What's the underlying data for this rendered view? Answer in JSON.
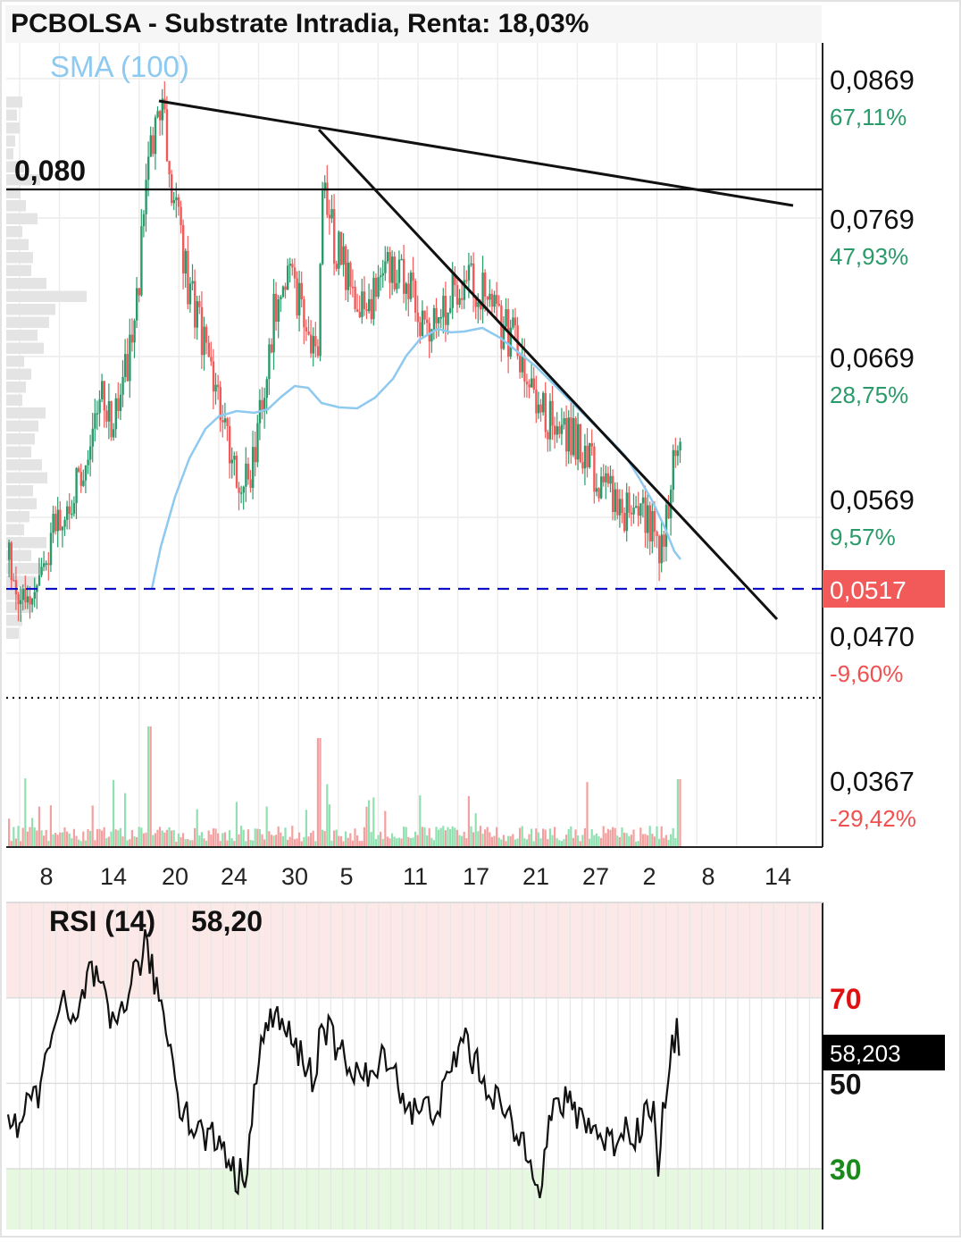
{
  "title": "PCBOLSA - Substrate Intradia, Renta: 18,03%",
  "indicator_label": "SMA (100)",
  "level_label": "0,080",
  "price_axis": [
    {
      "price": "0,0869",
      "pct": "67,11%",
      "pct_color": "#2a9a6a"
    },
    {
      "price": "0,0769",
      "pct": "47,93%",
      "pct_color": "#2a9a6a"
    },
    {
      "price": "0,0669",
      "pct": "28,75%",
      "pct_color": "#2a9a6a"
    },
    {
      "price": "0,0569",
      "pct": "9,57%",
      "pct_color": "#2a9a6a"
    },
    {
      "price": "0,0470",
      "pct": "-9,60%",
      "pct_color": "#f05050"
    },
    {
      "price": "0,0367",
      "pct": "-29,42%",
      "pct_color": "#f05050"
    }
  ],
  "current_price": "0,0517",
  "x_axis_labels": [
    "8",
    "14",
    "20",
    "24",
    "30",
    "5",
    "11",
    "17",
    "21",
    "27",
    "2",
    "8",
    "14"
  ],
  "rsi": {
    "label": "RSI (14)",
    "value": "58,20",
    "current": "58,203",
    "levels": [
      {
        "text": "70",
        "color": "#e01010"
      },
      {
        "text": "50",
        "color": "#111111"
      },
      {
        "text": "30",
        "color": "#1a8a1a"
      }
    ]
  },
  "colors": {
    "up": "#2a9a6a",
    "down": "#f25a5a",
    "sma": "#8ec9f0",
    "price_line": "#1010c8",
    "current_badge": "#f25a5a",
    "overbought_zone": "#fde8e8",
    "oversold_zone": "#e6f8e0"
  },
  "chart_data": [
    {
      "type": "line",
      "title": "PCBOLSA - Substrate Intradia, Renta: 18,03%",
      "description_series": "Intraday candlestick price with SMA(100), horizontal level 0,080, two descending trendlines, dashed current price line",
      "y_range": [
        0.0345,
        0.0895
      ],
      "x_ticks": [
        "8",
        "14",
        "20",
        "24",
        "30",
        "5",
        "11",
        "17",
        "21",
        "27",
        "2",
        "8",
        "14"
      ],
      "level": 0.08,
      "current_price": 0.0517,
      "support": 0.0445,
      "series": [
        {
          "name": "SMA (100)",
          "sample_x": [
            "20",
            "24",
            "30",
            "5",
            "11",
            "17",
            "21",
            "27",
            "2"
          ],
          "values": [
            0.0525,
            0.062,
            0.0648,
            0.0635,
            0.068,
            0.0695,
            0.066,
            0.06,
            0.0525
          ]
        },
        {
          "name": "price_close_approx",
          "sample_x": [
            "8",
            "14",
            "20",
            "24",
            "30",
            "5",
            "11",
            "17",
            "21",
            "27",
            "2"
          ],
          "values": [
            0.043,
            0.056,
            0.0835,
            0.051,
            0.068,
            0.078,
            0.069,
            0.07,
            0.063,
            0.05,
            0.0517
          ]
        }
      ]
    },
    {
      "type": "line",
      "title": "RSI (14)",
      "y_range": [
        0,
        100
      ],
      "levels": [
        70,
        50,
        30
      ],
      "last_value": 58.203,
      "series": [
        {
          "name": "RSI (14)",
          "sample_x": [
            "8",
            "14",
            "20",
            "24",
            "30",
            "5",
            "11",
            "17",
            "21",
            "27",
            "2"
          ],
          "values": [
            42,
            62,
            78,
            28,
            62,
            52,
            48,
            62,
            36,
            40,
            58.2
          ]
        }
      ]
    }
  ]
}
